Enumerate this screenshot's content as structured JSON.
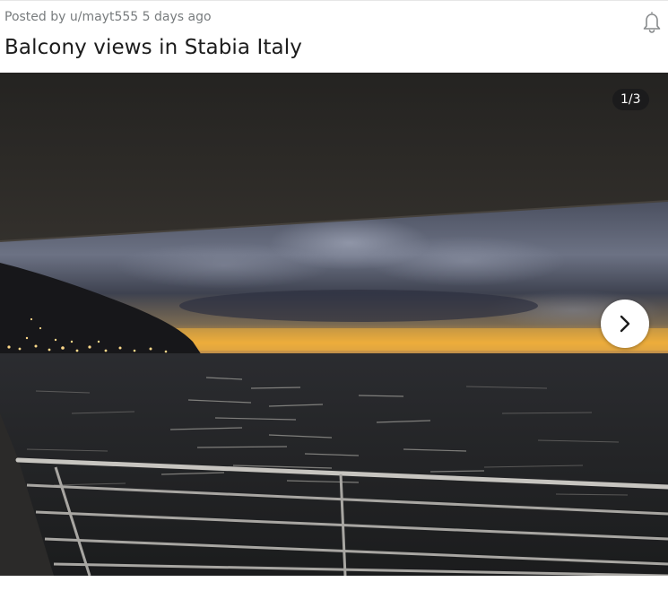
{
  "post": {
    "meta_prefix": "Posted by",
    "author": "u/mayt555",
    "age": "5 days ago",
    "title": "Balcony views in Stabia Italy"
  },
  "gallery": {
    "counter": "1/3",
    "image_description_icon": "landscape-photo",
    "next_icon": "chevron-right-icon"
  },
  "icons": {
    "notification": "bell-icon"
  },
  "colors": {
    "text_primary": "#1c1c1c",
    "text_meta": "#787c7e",
    "counter_bg": "#1a1a1b",
    "next_button_bg": "#ffffff"
  }
}
